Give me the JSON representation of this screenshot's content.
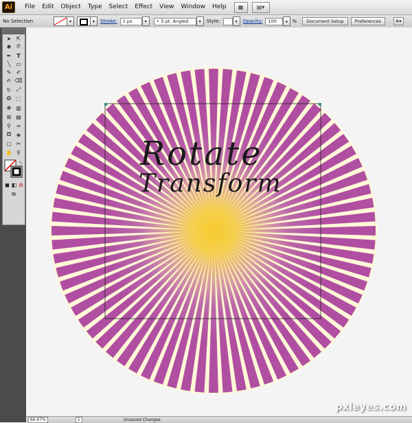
{
  "app": {
    "logo": "Ai",
    "logo_color": "#ff9e1b"
  },
  "menu": {
    "items": [
      "File",
      "Edit",
      "Object",
      "Type",
      "Select",
      "Effect",
      "View",
      "Window",
      "Help"
    ]
  },
  "control_bar": {
    "selection": "No Selection",
    "stroke_label": "Stroke:",
    "stroke_value": "1 px",
    "brush_value": "5 pt. Angled",
    "style_label": "Style:",
    "opacity_label": "Opacity:",
    "opacity_value": "100",
    "opacity_unit": "%",
    "document_setup": "Document Setup",
    "preferences": "Preferences"
  },
  "artwork": {
    "annotation_line1": "Rotate",
    "annotation_line2": "Transform",
    "ray_color": "#b04fa2",
    "gap_color": "#fff8d8",
    "center_color": "#f6c92c",
    "ray_count": 72
  },
  "statusbar": {
    "zoom": "66.67%",
    "page": "1",
    "status": "Unsaved Changes"
  },
  "watermark": "pxleyes.com"
}
